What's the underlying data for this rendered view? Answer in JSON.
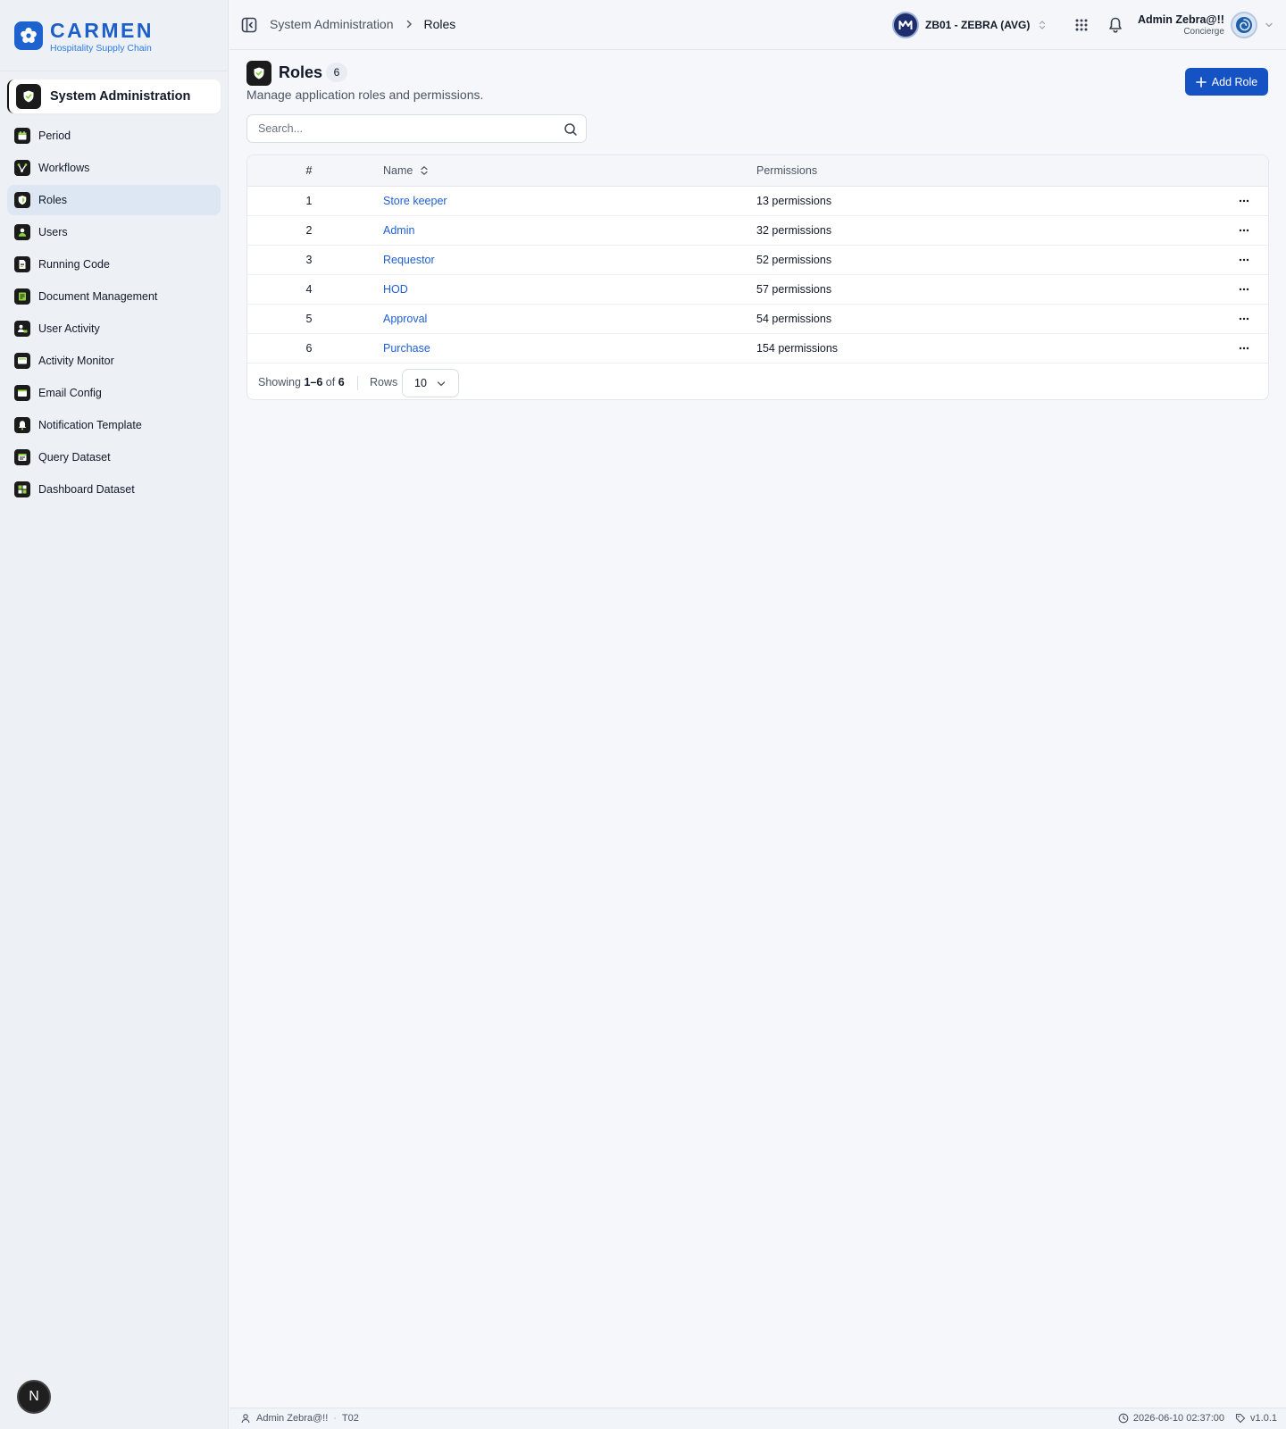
{
  "brand": {
    "name": "CARMEN",
    "tagline": "Hospitality Supply Chain",
    "icon": "flower-logo-icon"
  },
  "sidebar": {
    "module_label": "System Administration",
    "module_icon": "shield-check-icon",
    "items": [
      {
        "label": "Period",
        "icon": "calendar-icon",
        "active": false
      },
      {
        "label": "Workflows",
        "icon": "workflow-icon",
        "active": false
      },
      {
        "label": "Roles",
        "icon": "shield-icon",
        "active": true
      },
      {
        "label": "Users",
        "icon": "user-icon",
        "active": false
      },
      {
        "label": "Running Code",
        "icon": "file-code-icon",
        "active": false
      },
      {
        "label": "Document Management",
        "icon": "document-icon",
        "active": false
      },
      {
        "label": "User Activity",
        "icon": "user-activity-icon",
        "active": false
      },
      {
        "label": "Activity Monitor",
        "icon": "monitor-icon",
        "active": false
      },
      {
        "label": "Email Config",
        "icon": "mail-icon",
        "active": false
      },
      {
        "label": "Notification Template",
        "icon": "bell-icon",
        "active": false
      },
      {
        "label": "Query Dataset",
        "icon": "database-icon",
        "active": false
      },
      {
        "label": "Dashboard Dataset",
        "icon": "dashboard-icon",
        "active": false
      }
    ],
    "fab_label": "N"
  },
  "topbar": {
    "breadcrumb_parent": "System Administration",
    "breadcrumb_current": "Roles",
    "tenant_label": "ZB01 - ZEBRA (AVG)",
    "user_name": "Admin Zebra@!!",
    "user_role": "Concierge"
  },
  "page": {
    "title": "Roles",
    "count": "6",
    "description": "Manage application roles and permissions.",
    "add_label": "Add Role",
    "search_placeholder": "Search..."
  },
  "table": {
    "columns": {
      "num": "#",
      "name": "Name",
      "permissions": "Permissions"
    },
    "rows": [
      {
        "num": "1",
        "name": "Store keeper",
        "permissions": "13 permissions"
      },
      {
        "num": "2",
        "name": "Admin",
        "permissions": "32 permissions"
      },
      {
        "num": "3",
        "name": "Requestor",
        "permissions": "52 permissions"
      },
      {
        "num": "4",
        "name": "HOD",
        "permissions": "57 permissions"
      },
      {
        "num": "5",
        "name": "Approval",
        "permissions": "54 permissions"
      },
      {
        "num": "6",
        "name": "Purchase",
        "permissions": "154 permissions"
      }
    ],
    "footer": {
      "showing_prefix": "Showing",
      "range": "1–6",
      "of": "of",
      "total": "6",
      "rows_label": "Rows",
      "rows_value": "10"
    }
  },
  "statusbar": {
    "user": "Admin Zebra@!!",
    "tenant_code": "T02",
    "datetime": "2026-06-10 02:37:00",
    "version": "v1.0.1"
  },
  "colors": {
    "accent": "#1553c5",
    "link": "#1f5fd1",
    "brand": "#1d5fc8",
    "active_nav": "#dde6f3"
  }
}
